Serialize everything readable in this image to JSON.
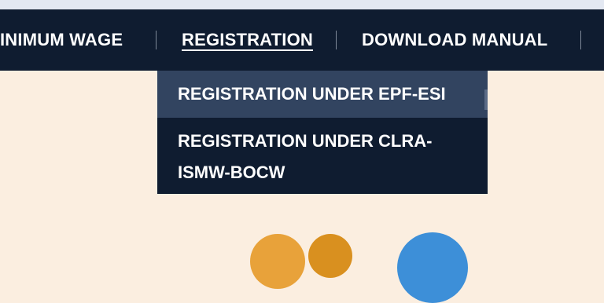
{
  "nav": {
    "items": [
      {
        "label": "INIMUM WAGE"
      },
      {
        "label": "REGISTRATION"
      },
      {
        "label": "DOWNLOAD MANUAL"
      }
    ]
  },
  "dropdown": {
    "items": [
      {
        "label": "REGISTRATION UNDER EPF-ESI"
      },
      {
        "label_line1": "REGISTRATION UNDER CLRA-",
        "label_line2": "ISMW-BOCW"
      }
    ]
  },
  "colors": {
    "navbar_bg": "#0f1c30",
    "hover_bg": "#324460",
    "page_bg": "#fbeee0",
    "text": "#ffffff"
  }
}
